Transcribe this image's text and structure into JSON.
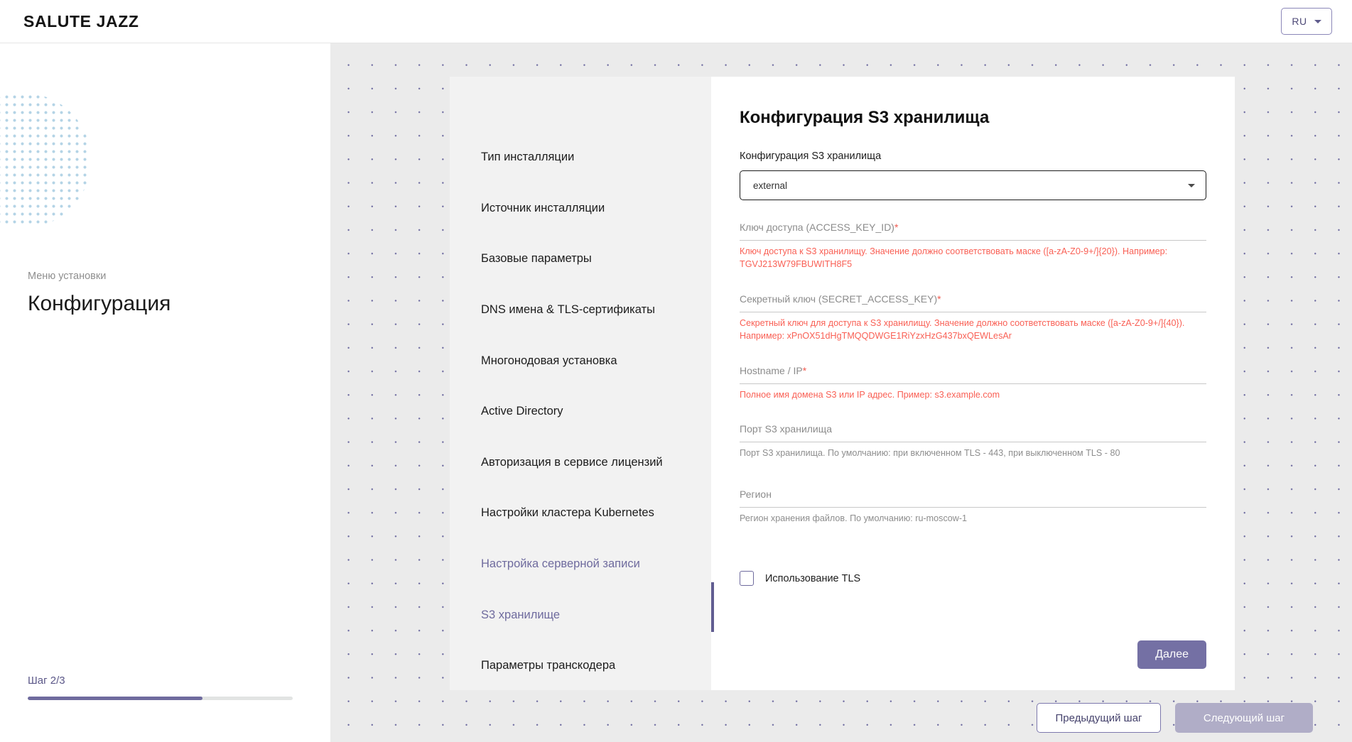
{
  "header": {
    "brand": "SALUTE JAZZ",
    "lang": "RU",
    "lang_caret_icon": "chevron-down-icon"
  },
  "sidebar": {
    "subtitle": "Меню установки",
    "title": "Конфигурация",
    "step_label": "Шаг 2/3",
    "progress_percent": 66,
    "decoration_icon": "dot-grid-circle"
  },
  "nav": {
    "items": [
      {
        "label": "Тип инсталляции",
        "active": false
      },
      {
        "label": "Источник инсталляции",
        "active": false
      },
      {
        "label": "Базовые параметры",
        "active": false
      },
      {
        "label": "DNS имена & TLS-сертификаты",
        "active": false
      },
      {
        "label": "Многонодовая установка",
        "active": false
      },
      {
        "label": "Active Directory",
        "active": false
      },
      {
        "label": "Авторизация в сервисе лицензий",
        "active": false
      },
      {
        "label": "Настройки кластера Kubernetes",
        "active": false
      },
      {
        "label": "Настройка серверной записи",
        "active": true
      },
      {
        "label": "S3 хранилище",
        "active": true
      },
      {
        "label": "Параметры транскодера",
        "active": false
      }
    ]
  },
  "form": {
    "title": "Конфигурация S3 хранилища",
    "select": {
      "label": "Конфигурация S3 хранилища",
      "value": "external",
      "caret_icon": "chevron-down-icon"
    },
    "fields": [
      {
        "label": "Ключ доступа (ACCESS_KEY_ID)",
        "required": true,
        "value": "",
        "hint": "Ключ доступа к S3 хранилищу. Значение должно соответствовать маске ([a-zA-Z0-9+/]{20}). Например: TGVJ213W79FBUWITH8F5",
        "hint_state": "error"
      },
      {
        "label": "Секретный ключ (SECRET_ACCESS_KEY)",
        "required": true,
        "value": "",
        "hint": "Секретный ключ для доступа к S3 хранилищу. Значение должно соответствовать маске ([a-zA-Z0-9+/]{40}). Например: xPnOX51dHgTMQQDWGE1RiYzxHzG437bxQEWLesAr",
        "hint_state": "error"
      },
      {
        "label": "Hostname / IP",
        "required": true,
        "value": "",
        "hint": "Полное имя домена S3 или IP адрес. Пример: s3.example.com",
        "hint_state": "error"
      },
      {
        "label": "Порт S3 хранилища",
        "required": false,
        "value": "",
        "hint": "Порт S3 хранилища. По умолчанию: при включенном TLS - 443, при выключенном TLS - 80",
        "hint_state": "normal"
      },
      {
        "label": "Регион",
        "required": false,
        "value": "",
        "hint": "Регион хранения файлов. По умолчанию: ru-moscow-1",
        "hint_state": "normal"
      }
    ],
    "checkbox": {
      "label": "Использование TLS",
      "checked": false
    },
    "submit_label": "Далее"
  },
  "footer": {
    "prev_label": "Предыдущий шаг",
    "next_label": "Следующий шаг"
  },
  "colors": {
    "accent": "#6f6b9e",
    "accent_button": "#7470a4",
    "accent_disabled": "#b0adc7",
    "error": "#f96055",
    "required_star": "#f05a4f",
    "canvas": "#ebebeb",
    "nav_panel": "#f2f2f2"
  }
}
